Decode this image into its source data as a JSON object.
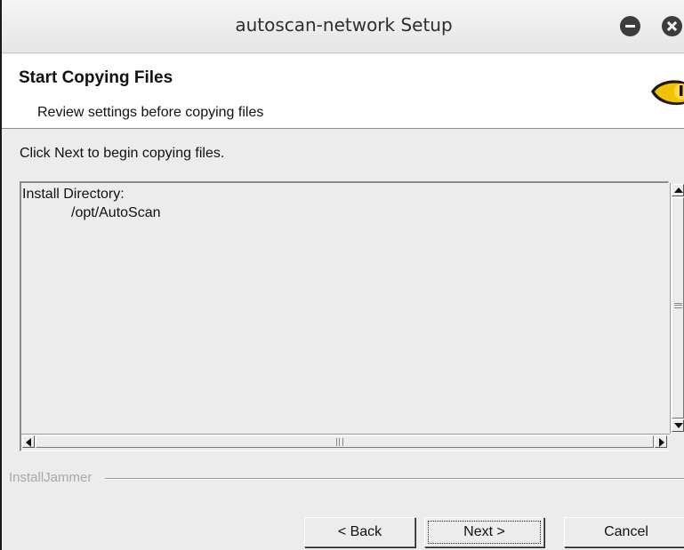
{
  "window": {
    "title": "autoscan-network Setup",
    "controls": [
      "minimize-icon",
      "close-icon"
    ]
  },
  "header": {
    "title": "Start Copying Files",
    "subtitle": "Review settings before copying files",
    "icon": "eye-logo-icon"
  },
  "body": {
    "instruction": "Click Next to begin copying files.",
    "settings_lines": [
      "Install Directory:",
      "/opt/AutoScan"
    ]
  },
  "branding": {
    "label": "InstallJammer"
  },
  "buttons": {
    "back": "< Back",
    "next": "Next >",
    "cancel": "Cancel"
  },
  "colors": {
    "window_bg": "#ececec",
    "header_bg": "#ffffff",
    "logo_yellow": "#f2c200",
    "logo_dark": "#1a1a1a"
  }
}
